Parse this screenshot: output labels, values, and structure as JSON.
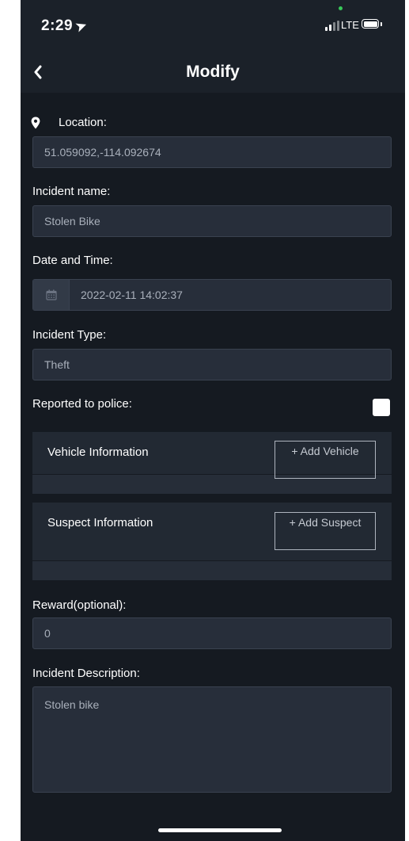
{
  "status_bar": {
    "time": "2:29",
    "network": "LTE"
  },
  "nav": {
    "title": "Modify",
    "back_icon": "chevron-left-icon"
  },
  "form": {
    "location": {
      "label": "Location:",
      "value": "51.059092,-114.092674",
      "icon": "map-pin-icon"
    },
    "incident_name": {
      "label": "Incident name:",
      "value": "Stolen Bike"
    },
    "date_time": {
      "label": "Date and Time:",
      "value": "2022-02-11 14:02:37",
      "icon": "calendar-icon"
    },
    "incident_type": {
      "label": "Incident Type:",
      "value": "Theft"
    },
    "reported_to_police": {
      "label": "Reported to police:",
      "checked": false
    },
    "vehicle": {
      "label": "Vehicle Information",
      "button": "+ Add Vehicle"
    },
    "suspect": {
      "label": "Suspect Information",
      "button": "+ Add Suspect"
    },
    "reward": {
      "label": "Reward(optional):",
      "value": "0"
    },
    "description": {
      "label": "Incident Description:",
      "value": "Stolen bike"
    }
  },
  "colors": {
    "background": "#151a21",
    "field": "#272e3a",
    "section": "#222933",
    "accent_green": "#38c859"
  }
}
